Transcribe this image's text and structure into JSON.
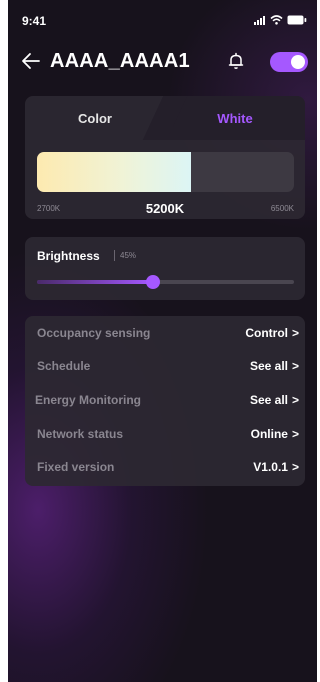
{
  "status_bar": {
    "time": "9:41"
  },
  "header": {
    "device_name": "AAAA_AAAA1",
    "power_on": true
  },
  "color_card": {
    "tabs": [
      "Color",
      "White"
    ],
    "active_tab": "White",
    "cct_min": "2700K",
    "cct_current": "5200K",
    "cct_max": "6500K",
    "cct_fill_fraction": 0.6
  },
  "brightness": {
    "label": "Brightness",
    "value": "45%",
    "level_fraction": 0.45
  },
  "settings": [
    {
      "label": "Occupancy sensing",
      "value": "Control"
    },
    {
      "label": "Schedule",
      "value": "See all"
    },
    {
      "label": "Energy Monitoring",
      "value": "See all"
    },
    {
      "label": "Network status",
      "value": "Online"
    },
    {
      "label": "Fixed version",
      "value": "V1.0.1"
    }
  ],
  "colors": {
    "accent": "#a558ff",
    "background": "#17121c",
    "card": "#2c2832"
  }
}
